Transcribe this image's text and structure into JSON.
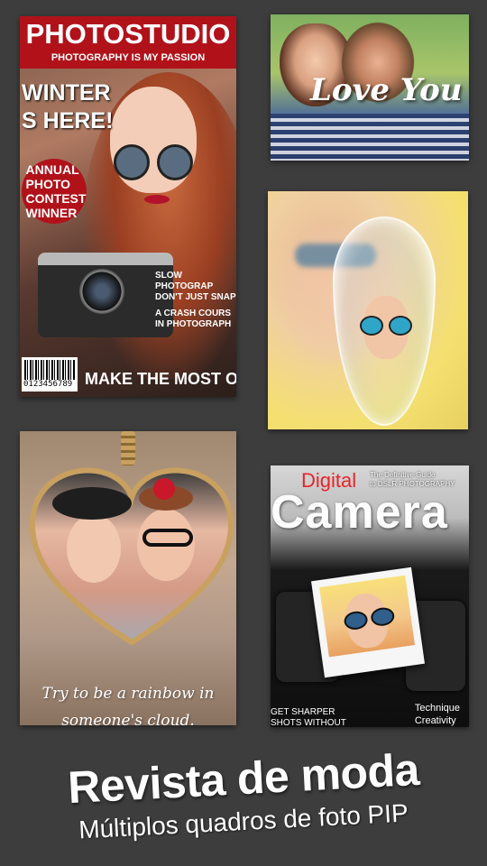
{
  "cards": {
    "photostudio": {
      "title": "PHOTOSTUDIO",
      "subtitle": "PHOTOGRAPHY IS MY PASSION",
      "headline_line1": "WINTER",
      "headline_line2": "S HERE!",
      "badge_line1": "ANNUAL",
      "badge_line2": "PHOTO",
      "badge_line3": "CONTEST",
      "badge_line4": "WINNER",
      "side_line1": "SLOW PHOTOGRAP",
      "side_line2": "DON'T JUST SNAP",
      "side_line3": "A CRASH COURS",
      "side_line4": "IN PHOTOGRAPH",
      "barcode_number": "0123456789",
      "bottom_text": "MAKE THE MOST OF"
    },
    "love": {
      "overlay_text": "Love You"
    },
    "heart": {
      "quote_line1": "Try to be a rainbow in",
      "quote_line2": "someone's cloud."
    },
    "camera": {
      "label_digital": "Digital",
      "guide_line1": "The Definitive Guide",
      "guide_line2": "to DSLR PHOTOGRAPHY",
      "title": "Camera",
      "bottom_left_line1": "GET SHARPER",
      "bottom_left_line2": "SHOTS WITHOUT",
      "bottom_right_line1": "Technique",
      "bottom_right_line2": "Creativity"
    }
  },
  "headline": "Revista de moda",
  "subline": "Múltiplos quadros de foto PIP",
  "colors": {
    "background": "#3d3d3d",
    "magazine_red": "#b1121a",
    "camera_red": "#e8242a"
  }
}
